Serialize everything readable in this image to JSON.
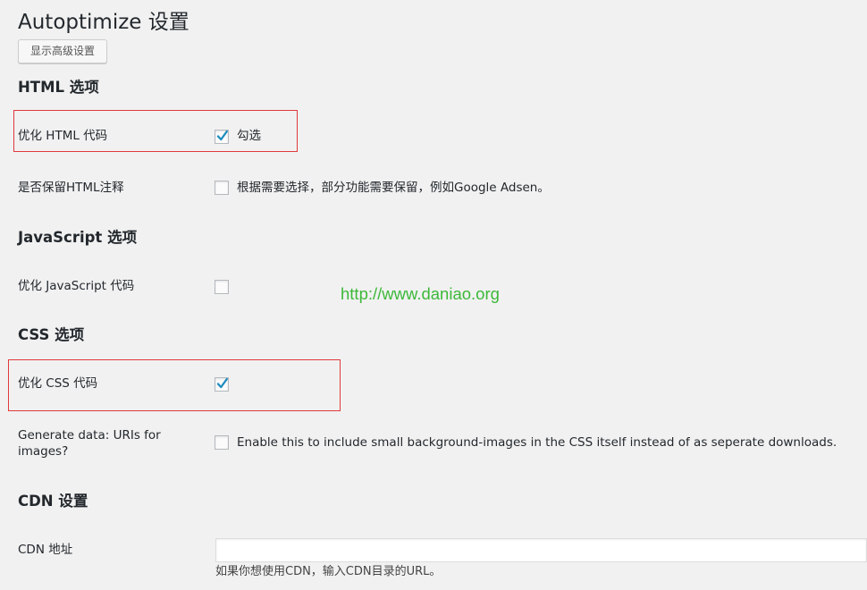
{
  "page": {
    "title": "Autoptimize 设置",
    "advanced_button": "显示高级设置",
    "watermark": "http://www.daniao.org"
  },
  "html_section": {
    "title": "HTML 选项",
    "rows": [
      {
        "label": "优化 HTML 代码",
        "checked": true,
        "text": "勾选"
      },
      {
        "label": "是否保留HTML注释",
        "checked": false,
        "text": "根据需要选择，部分功能需要保留，例如Google Adsen。"
      }
    ]
  },
  "js_section": {
    "title": "JavaScript 选项",
    "rows": [
      {
        "label": "优化 JavaScript 代码",
        "checked": false
      }
    ]
  },
  "css_section": {
    "title": "CSS 选项",
    "rows": [
      {
        "label": "优化 CSS 代码",
        "checked": true
      },
      {
        "label": "Generate data: URIs for images?",
        "checked": false,
        "text": "Enable this to include small background-images in the CSS itself instead of as seperate downloads."
      }
    ]
  },
  "cdn_section": {
    "title": "CDN 设置",
    "label": "CDN 地址",
    "input_value": "",
    "description": "如果你想使用CDN，输入CDN目录的URL。"
  },
  "colors": {
    "highlight_box": "#e0393c",
    "checkmark": "#1e8cbe",
    "watermark": "#3cb838",
    "background": "#f1f1f1"
  }
}
